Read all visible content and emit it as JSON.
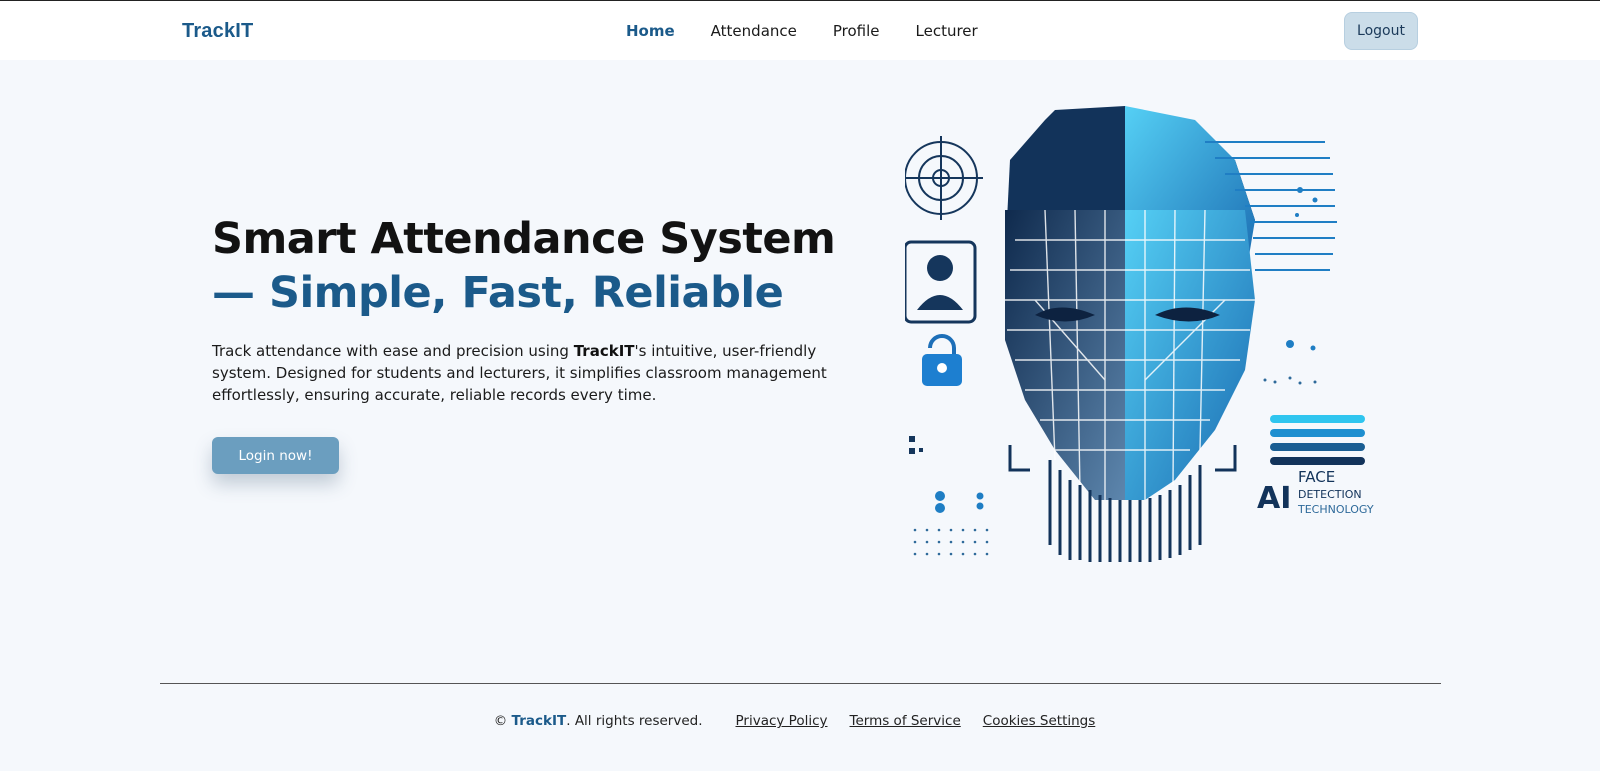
{
  "header": {
    "brand": "TrackIT",
    "nav": [
      "Home",
      "Attendance",
      "Profile",
      "Lecturer"
    ],
    "active_nav": "Home",
    "logout_label": "Logout"
  },
  "hero": {
    "title_line1": "Smart Attendance System",
    "title_line2": "— Simple, Fast, Reliable",
    "desc_before": "Track attendance with ease and precision using ",
    "desc_brand": "TrackIT",
    "desc_after": "'s intuitive, user-friendly system. Designed for students and lecturers, it simplifies classroom management effortlessly, ensuring accurate, reliable records every time.",
    "cta_label": "Login now!"
  },
  "illustration": {
    "ai_text": "AI",
    "face_text": "FACE",
    "detection_text": "DETECTION",
    "technology_text": "TECHNOLOGY",
    "icons": [
      "target-icon",
      "user-id-icon",
      "lock-icon",
      "face-scan-icon"
    ]
  },
  "footer": {
    "copyright_prefix": "© ",
    "copyright_brand": "TrackIT",
    "copyright_suffix": ". All rights reserved.",
    "links": [
      "Privacy Policy",
      "Terms of Service",
      "Cookies Settings"
    ]
  },
  "colors": {
    "brand": "#1b5a8a",
    "background": "#f5f8fc",
    "cta": "#6b9ebf",
    "logout_bg": "#cbdde9"
  }
}
